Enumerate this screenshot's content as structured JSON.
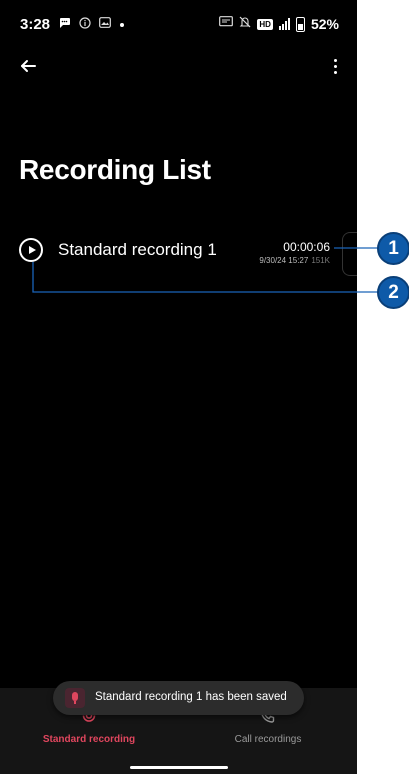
{
  "status_bar": {
    "time": "3:28",
    "icons": [
      "chat-bubble-icon",
      "info-icon",
      "gallery-icon",
      "dot-icon"
    ],
    "right_icons": [
      "cast-icon",
      "mute-icon",
      "hd-icon",
      "signal-icon",
      "battery-icon"
    ],
    "hd_label": "HD",
    "battery": "52%"
  },
  "app_bar": {
    "back_icon": "arrow-left-icon",
    "menu_icon": "more-vert-icon"
  },
  "title": "Recording List",
  "recordings": [
    {
      "name": "Standard recording 1",
      "duration": "00:00:06",
      "datetime": "9/30/24 15:27",
      "size": "151K"
    }
  ],
  "bottom_nav": {
    "tabs": [
      {
        "label": "Standard recording",
        "icon": "mic-icon",
        "active": true
      },
      {
        "label": "Call recordings",
        "icon": "phone-icon",
        "active": false
      }
    ]
  },
  "toast": {
    "message": "Standard recording 1 has been saved",
    "icon": "mic-icon"
  },
  "callouts": [
    {
      "label": "1"
    },
    {
      "label": "2"
    }
  ],
  "colors": {
    "background": "#000000",
    "accent": "#e0465e",
    "callout": "#0e5aa8"
  }
}
